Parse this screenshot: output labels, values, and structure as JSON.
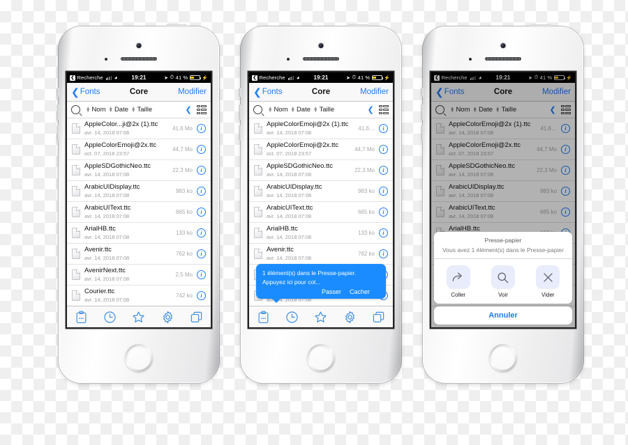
{
  "status_bar": {
    "back_label": "Recherche",
    "back_icon": "back-arrow-icon",
    "time": "19:21",
    "battery_percent": "41 %",
    "battery_fill_color": "#ffcc00",
    "location_icon": "location-arrow-icon",
    "alarm_icon": "alarm-clock-icon",
    "wifi_icon": "wifi-icon",
    "charging_icon": "lightning-bolt-icon"
  },
  "nav_bar": {
    "back_label": "Fonts",
    "title": "Core",
    "action_label": "Modifier",
    "tint_color": "#1f7bf3"
  },
  "sort_bar": {
    "search_icon": "magnifier-icon",
    "options": [
      "Nom",
      "Date",
      "Taille"
    ],
    "collapse_icon": "chevron-left-icon",
    "view_icon": "grid-list-view-icon"
  },
  "files": [
    {
      "name": "AppleColor...ji@2x (1).ttc",
      "name_full": "AppleColorEmoji@2x (1).ttc",
      "date": "avr. 14, 2018 07:08",
      "size": "41,6 Mo",
      "size_trunc": "41,6…"
    },
    {
      "name": "AppleColorEmoji@2x.ttc",
      "name_full": "AppleColorEmoji@2x.ttc",
      "date": "oct. 07, 2018 23:57",
      "size": "44,7 Mo",
      "size_trunc": "44,7 Mo"
    },
    {
      "name": "AppleSDGothicNeo.ttc",
      "name_full": "AppleSDGothicNeo.ttc",
      "date": "avr. 14, 2018 07:08",
      "size": "22,3 Mo",
      "size_trunc": "22,3 Mo"
    },
    {
      "name": "ArabicUIDisplay.ttc",
      "name_full": "ArabicUIDisplay.ttc",
      "date": "avr. 14, 2018 07:08",
      "size": "983 ko",
      "size_trunc": "983 ko"
    },
    {
      "name": "ArabicUIText.ttc",
      "name_full": "ArabicUIText.ttc",
      "date": "avr. 14, 2018 07:08",
      "size": "665 ko",
      "size_trunc": "665 ko"
    },
    {
      "name": "ArialHB.ttc",
      "name_full": "ArialHB.ttc",
      "date": "avr. 14, 2018 07:08",
      "size": "133 ko",
      "size_trunc": "133 ko"
    },
    {
      "name": "Avenir.ttc",
      "name_full": "Avenir.ttc",
      "date": "avr. 14, 2018 07:08",
      "size": "762 ko",
      "size_trunc": "762 ko"
    },
    {
      "name": "AvenirNext.ttc",
      "name_full": "AvenirNext.ttc",
      "date": "avr. 14, 2018 07:08",
      "size": "2,5 Mo",
      "size_trunc": "2,5 Mo"
    },
    {
      "name": "Courier.ttc",
      "name_full": "Courier.ttc",
      "date": "avr. 14, 2018 07:08",
      "size": "742 ko",
      "size_trunc": "742 ko"
    }
  ],
  "file_row": {
    "info_glyph": "i",
    "icon": "document-icon"
  },
  "tab_bar": {
    "items": [
      {
        "icon": "clipboard-icon",
        "name": "tab-clipboard"
      },
      {
        "icon": "clock-icon",
        "name": "tab-recents"
      },
      {
        "icon": "star-icon",
        "name": "tab-favorites"
      },
      {
        "icon": "gear-icon",
        "name": "tab-settings"
      },
      {
        "icon": "windows-copy-icon",
        "name": "tab-windows"
      }
    ],
    "tint_color": "#3f8fe0"
  },
  "toast": {
    "message": "1 élément(s) dans le Presse-papier. Appuyez ici pour col...",
    "primary_label": "Passer",
    "secondary_label": "Cacher",
    "background_color": "#1a8cff"
  },
  "action_sheet": {
    "title": "Presse-papier",
    "subtitle": "Vous avez 1 élément(s) dans le Presse-papier",
    "actions": [
      {
        "label": "Coller",
        "icon": "share-arrow-icon"
      },
      {
        "label": "Voir",
        "icon": "magnifier-icon"
      },
      {
        "label": "Vider",
        "icon": "close-x-icon"
      }
    ],
    "cancel_label": "Annuler"
  }
}
